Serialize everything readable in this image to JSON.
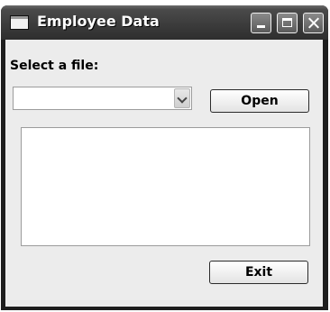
{
  "window": {
    "title": "Employee Data"
  },
  "titlebar_icons": [
    "minimize-icon",
    "maximize-icon",
    "close-icon"
  ],
  "form": {
    "file_label": "Select a file:",
    "file_combo_value": "",
    "open_label": "Open",
    "exit_label": "Exit",
    "list_items": []
  }
}
